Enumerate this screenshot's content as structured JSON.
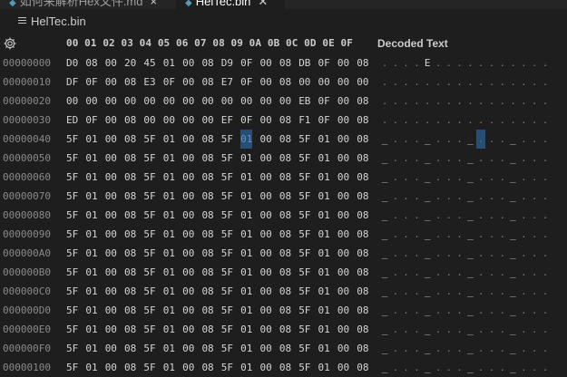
{
  "tabs": [
    {
      "label": "如何来解析Hex文件.md",
      "icon": "markdown-icon",
      "close": "×"
    },
    {
      "label": "HelTec.bin",
      "icon": "binary-file-icon",
      "close": "✕"
    }
  ],
  "breadcrumb": {
    "file": "HelTec.bin",
    "icon": "file-lines-icon"
  },
  "header": {
    "settings_icon": "gear-icon",
    "columns": "00 01 02 03 04 05 06 07 08 09 0A 0B 0C 0D 0E 0F",
    "decoded_label": "Decoded Text"
  },
  "colors": {
    "selection": "#264f78",
    "background": "#1e1e1e"
  },
  "rows": [
    {
      "addr": "00000000",
      "bytes": [
        "D0",
        "08",
        "00",
        "20",
        "45",
        "01",
        "00",
        "08",
        "D9",
        "0F",
        "00",
        "08",
        "DB",
        "0F",
        "00",
        "08"
      ],
      "text": [
        ".",
        ".",
        ".",
        ".",
        "E",
        ".",
        ".",
        ".",
        ".",
        ".",
        ".",
        ".",
        ".",
        ".",
        ".",
        "."
      ]
    },
    {
      "addr": "00000010",
      "bytes": [
        "DF",
        "0F",
        "00",
        "08",
        "E3",
        "0F",
        "00",
        "08",
        "E7",
        "0F",
        "00",
        "08",
        "00",
        "00",
        "00",
        "00"
      ],
      "text": [
        ".",
        ".",
        ".",
        ".",
        ".",
        ".",
        ".",
        ".",
        ".",
        ".",
        ".",
        ".",
        ".",
        ".",
        ".",
        "."
      ]
    },
    {
      "addr": "00000020",
      "bytes": [
        "00",
        "00",
        "00",
        "00",
        "00",
        "00",
        "00",
        "00",
        "00",
        "00",
        "00",
        "00",
        "EB",
        "0F",
        "00",
        "08"
      ],
      "text": [
        ".",
        ".",
        ".",
        ".",
        ".",
        ".",
        ".",
        ".",
        ".",
        ".",
        ".",
        ".",
        ".",
        ".",
        ".",
        "."
      ]
    },
    {
      "addr": "00000030",
      "bytes": [
        "ED",
        "0F",
        "00",
        "08",
        "00",
        "00",
        "00",
        "00",
        "EF",
        "0F",
        "00",
        "08",
        "F1",
        "0F",
        "00",
        "08"
      ],
      "text": [
        ".",
        ".",
        ".",
        ".",
        ".",
        ".",
        ".",
        ".",
        ".",
        ".",
        ".",
        ".",
        ".",
        ".",
        ".",
        "."
      ]
    },
    {
      "addr": "00000040",
      "bytes": [
        "5F",
        "01",
        "00",
        "08",
        "5F",
        "01",
        "00",
        "08",
        "5F",
        "01",
        "00",
        "08",
        "5F",
        "01",
        "00",
        "08"
      ],
      "text": [
        "_",
        ".",
        ".",
        ".",
        "_",
        ".",
        ".",
        ".",
        "_",
        ".",
        ".",
        ".",
        "_",
        ".",
        ".",
        "."
      ]
    },
    {
      "addr": "00000050",
      "bytes": [
        "5F",
        "01",
        "00",
        "08",
        "5F",
        "01",
        "00",
        "08",
        "5F",
        "01",
        "00",
        "08",
        "5F",
        "01",
        "00",
        "08"
      ],
      "text": [
        "_",
        ".",
        ".",
        ".",
        "_",
        ".",
        ".",
        ".",
        "_",
        ".",
        ".",
        ".",
        "_",
        ".",
        ".",
        "."
      ]
    },
    {
      "addr": "00000060",
      "bytes": [
        "5F",
        "01",
        "00",
        "08",
        "5F",
        "01",
        "00",
        "08",
        "5F",
        "01",
        "00",
        "08",
        "5F",
        "01",
        "00",
        "08"
      ],
      "text": [
        "_",
        ".",
        ".",
        ".",
        "_",
        ".",
        ".",
        ".",
        "_",
        ".",
        ".",
        ".",
        "_",
        ".",
        ".",
        "."
      ]
    },
    {
      "addr": "00000070",
      "bytes": [
        "5F",
        "01",
        "00",
        "08",
        "5F",
        "01",
        "00",
        "08",
        "5F",
        "01",
        "00",
        "08",
        "5F",
        "01",
        "00",
        "08"
      ],
      "text": [
        "_",
        ".",
        ".",
        ".",
        "_",
        ".",
        ".",
        ".",
        "_",
        ".",
        ".",
        ".",
        "_",
        ".",
        ".",
        "."
      ]
    },
    {
      "addr": "00000080",
      "bytes": [
        "5F",
        "01",
        "00",
        "08",
        "5F",
        "01",
        "00",
        "08",
        "5F",
        "01",
        "00",
        "08",
        "5F",
        "01",
        "00",
        "08"
      ],
      "text": [
        "_",
        ".",
        ".",
        ".",
        "_",
        ".",
        ".",
        ".",
        "_",
        ".",
        ".",
        ".",
        "_",
        ".",
        ".",
        "."
      ]
    },
    {
      "addr": "00000090",
      "bytes": [
        "5F",
        "01",
        "00",
        "08",
        "5F",
        "01",
        "00",
        "08",
        "5F",
        "01",
        "00",
        "08",
        "5F",
        "01",
        "00",
        "08"
      ],
      "text": [
        "_",
        ".",
        ".",
        ".",
        "_",
        ".",
        ".",
        ".",
        "_",
        ".",
        ".",
        ".",
        "_",
        ".",
        ".",
        "."
      ]
    },
    {
      "addr": "000000A0",
      "bytes": [
        "5F",
        "01",
        "00",
        "08",
        "5F",
        "01",
        "00",
        "08",
        "5F",
        "01",
        "00",
        "08",
        "5F",
        "01",
        "00",
        "08"
      ],
      "text": [
        "_",
        ".",
        ".",
        ".",
        "_",
        ".",
        ".",
        ".",
        "_",
        ".",
        ".",
        ".",
        "_",
        ".",
        ".",
        "."
      ]
    },
    {
      "addr": "000000B0",
      "bytes": [
        "5F",
        "01",
        "00",
        "08",
        "5F",
        "01",
        "00",
        "08",
        "5F",
        "01",
        "00",
        "08",
        "5F",
        "01",
        "00",
        "08"
      ],
      "text": [
        "_",
        ".",
        ".",
        ".",
        "_",
        ".",
        ".",
        ".",
        "_",
        ".",
        ".",
        ".",
        "_",
        ".",
        ".",
        "."
      ]
    },
    {
      "addr": "000000C0",
      "bytes": [
        "5F",
        "01",
        "00",
        "08",
        "5F",
        "01",
        "00",
        "08",
        "5F",
        "01",
        "00",
        "08",
        "5F",
        "01",
        "00",
        "08"
      ],
      "text": [
        "_",
        ".",
        ".",
        ".",
        "_",
        ".",
        ".",
        ".",
        "_",
        ".",
        ".",
        ".",
        "_",
        ".",
        ".",
        "."
      ]
    },
    {
      "addr": "000000D0",
      "bytes": [
        "5F",
        "01",
        "00",
        "08",
        "5F",
        "01",
        "00",
        "08",
        "5F",
        "01",
        "00",
        "08",
        "5F",
        "01",
        "00",
        "08"
      ],
      "text": [
        "_",
        ".",
        ".",
        ".",
        "_",
        ".",
        ".",
        ".",
        "_",
        ".",
        ".",
        ".",
        "_",
        ".",
        ".",
        "."
      ]
    },
    {
      "addr": "000000E0",
      "bytes": [
        "5F",
        "01",
        "00",
        "08",
        "5F",
        "01",
        "00",
        "08",
        "5F",
        "01",
        "00",
        "08",
        "5F",
        "01",
        "00",
        "08"
      ],
      "text": [
        "_",
        ".",
        ".",
        ".",
        "_",
        ".",
        ".",
        ".",
        "_",
        ".",
        ".",
        ".",
        "_",
        ".",
        ".",
        "."
      ]
    },
    {
      "addr": "000000F0",
      "bytes": [
        "5F",
        "01",
        "00",
        "08",
        "5F",
        "01",
        "00",
        "08",
        "5F",
        "01",
        "00",
        "08",
        "5F",
        "01",
        "00",
        "08"
      ],
      "text": [
        "_",
        ".",
        ".",
        ".",
        "_",
        ".",
        ".",
        ".",
        "_",
        ".",
        ".",
        ".",
        "_",
        ".",
        ".",
        "."
      ]
    },
    {
      "addr": "00000100",
      "bytes": [
        "5F",
        "01",
        "00",
        "08",
        "5F",
        "01",
        "00",
        "08",
        "5F",
        "01",
        "00",
        "08",
        "5F",
        "01",
        "00",
        "08"
      ],
      "text": [
        "_",
        ".",
        ".",
        ".",
        "_",
        ".",
        ".",
        ".",
        "_",
        ".",
        ".",
        ".",
        "_",
        ".",
        ".",
        "."
      ]
    }
  ],
  "selection": {
    "row": 4,
    "col": 9
  }
}
